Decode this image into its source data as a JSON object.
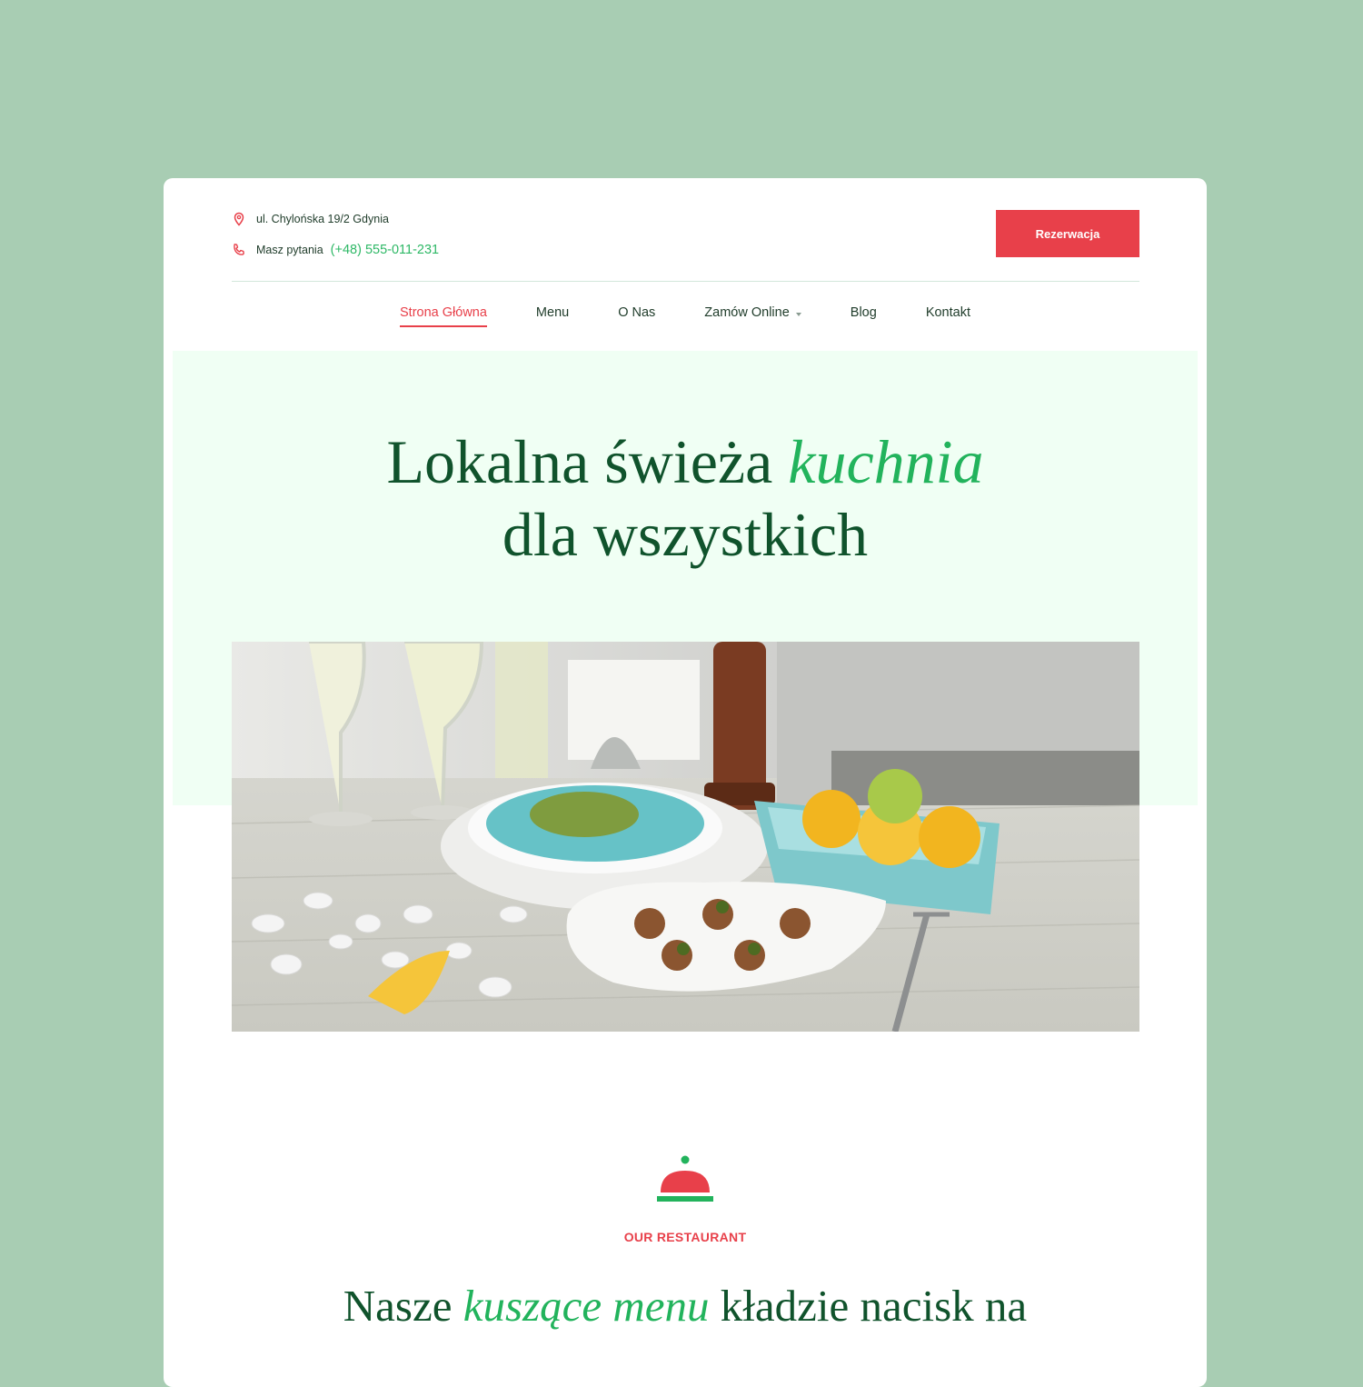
{
  "contact": {
    "address": "ul. Chylońska 19/2 Gdynia",
    "question_label": "Masz pytania",
    "phone": "(+48) 555-011-231"
  },
  "reserve_button": "Rezerwacja",
  "nav": [
    {
      "label": "Strona Główna",
      "active": true
    },
    {
      "label": "Menu"
    },
    {
      "label": "O Nas"
    },
    {
      "label": "Zamów Online",
      "dropdown": true
    },
    {
      "label": "Blog"
    },
    {
      "label": "Kontakt"
    }
  ],
  "hero": {
    "line1_prefix": "Lokalna świeża ",
    "line1_accent": "kuchnia",
    "line2": "dla wszystkich"
  },
  "section": {
    "eyebrow": "OUR RESTAURANT",
    "title_prefix": "Nasze ",
    "title_accent": "kuszące menu",
    "title_suffix": " kładzie nacisk na"
  },
  "colors": {
    "page_bg": "#a8cdb3",
    "accent_red": "#e8404a",
    "accent_green": "#22b35c",
    "dark_green": "#10532c",
    "hero_bg": "#f0fff4"
  },
  "icons": [
    "location-pin-icon",
    "phone-icon",
    "chevron-down-icon",
    "cloche-icon"
  ]
}
